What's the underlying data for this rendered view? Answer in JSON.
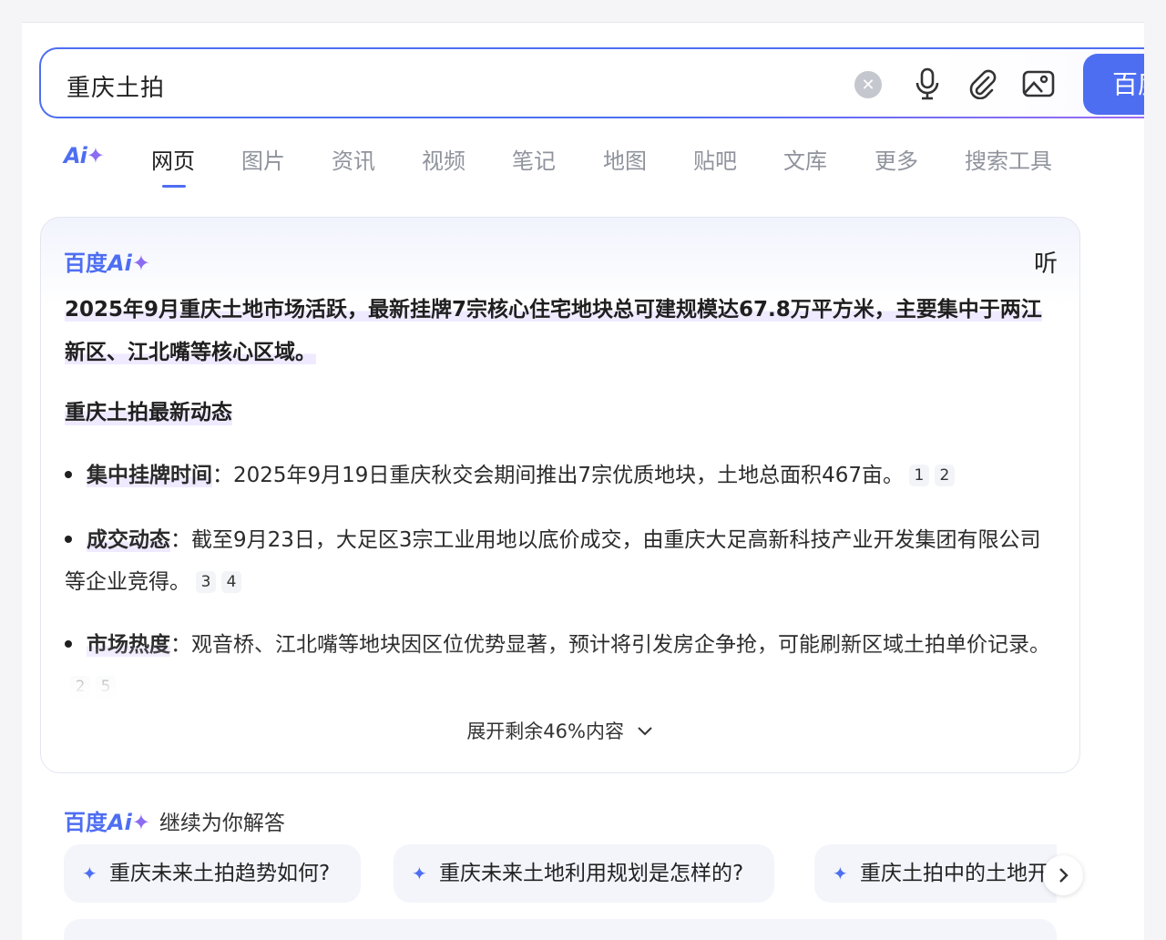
{
  "search": {
    "query": "重庆土拍",
    "button_label": "百度一下"
  },
  "icons": {
    "clear": "clear-icon",
    "mic": "mic-icon",
    "attach": "paperclip-icon",
    "image": "image-search-icon"
  },
  "tabs": {
    "ai_label": "Ai",
    "items": [
      "网页",
      "图片",
      "资讯",
      "视频",
      "笔记",
      "地图",
      "贴吧",
      "文库",
      "更多",
      "搜索工具"
    ],
    "active": "网页"
  },
  "ai_card": {
    "brand": "百度",
    "brand_ai": "Ai",
    "listen": "听",
    "summary": "2025年9月重庆土地市场活跃，最新挂牌7宗核心住宅地块总可建规模达67.8万平方米，主要集中于两江新区、江北嘴等核心区域。",
    "section_title": "重庆土拍最新动态",
    "bullets": [
      {
        "term": "集中挂牌时间",
        "text": "：2025年9月19日重庆秋交会期间推出7宗优质地块，土地总面积467亩。",
        "cites": [
          "1",
          "2"
        ]
      },
      {
        "term": "成交动态",
        "text": "：截至9月23日，大足区3宗工业用地以底价成交，由重庆大足高新科技产业开发集团有限公司等企业竞得。",
        "cites": [
          "3",
          "4"
        ]
      },
      {
        "term": "市场热度",
        "text": "：观音桥、江北嘴等地块因区位优势显著，预计将引发房企争抢，可能刷新区域土拍单价记录。",
        "cites": [
          "2",
          "5"
        ]
      }
    ],
    "expand_label": "展开剩余46%内容"
  },
  "continue": {
    "brand": "百度",
    "brand_ai": "Ai",
    "label": "继续为你解答",
    "chips": [
      "重庆未来土拍趋势如何?",
      "重庆未来土地利用规划是怎样的?",
      "重庆土拍中的土地开发"
    ]
  },
  "colors": {
    "accent": "#4e6ef2",
    "accent_purple": "#8b6cf3",
    "highlight": "#efeaff"
  }
}
